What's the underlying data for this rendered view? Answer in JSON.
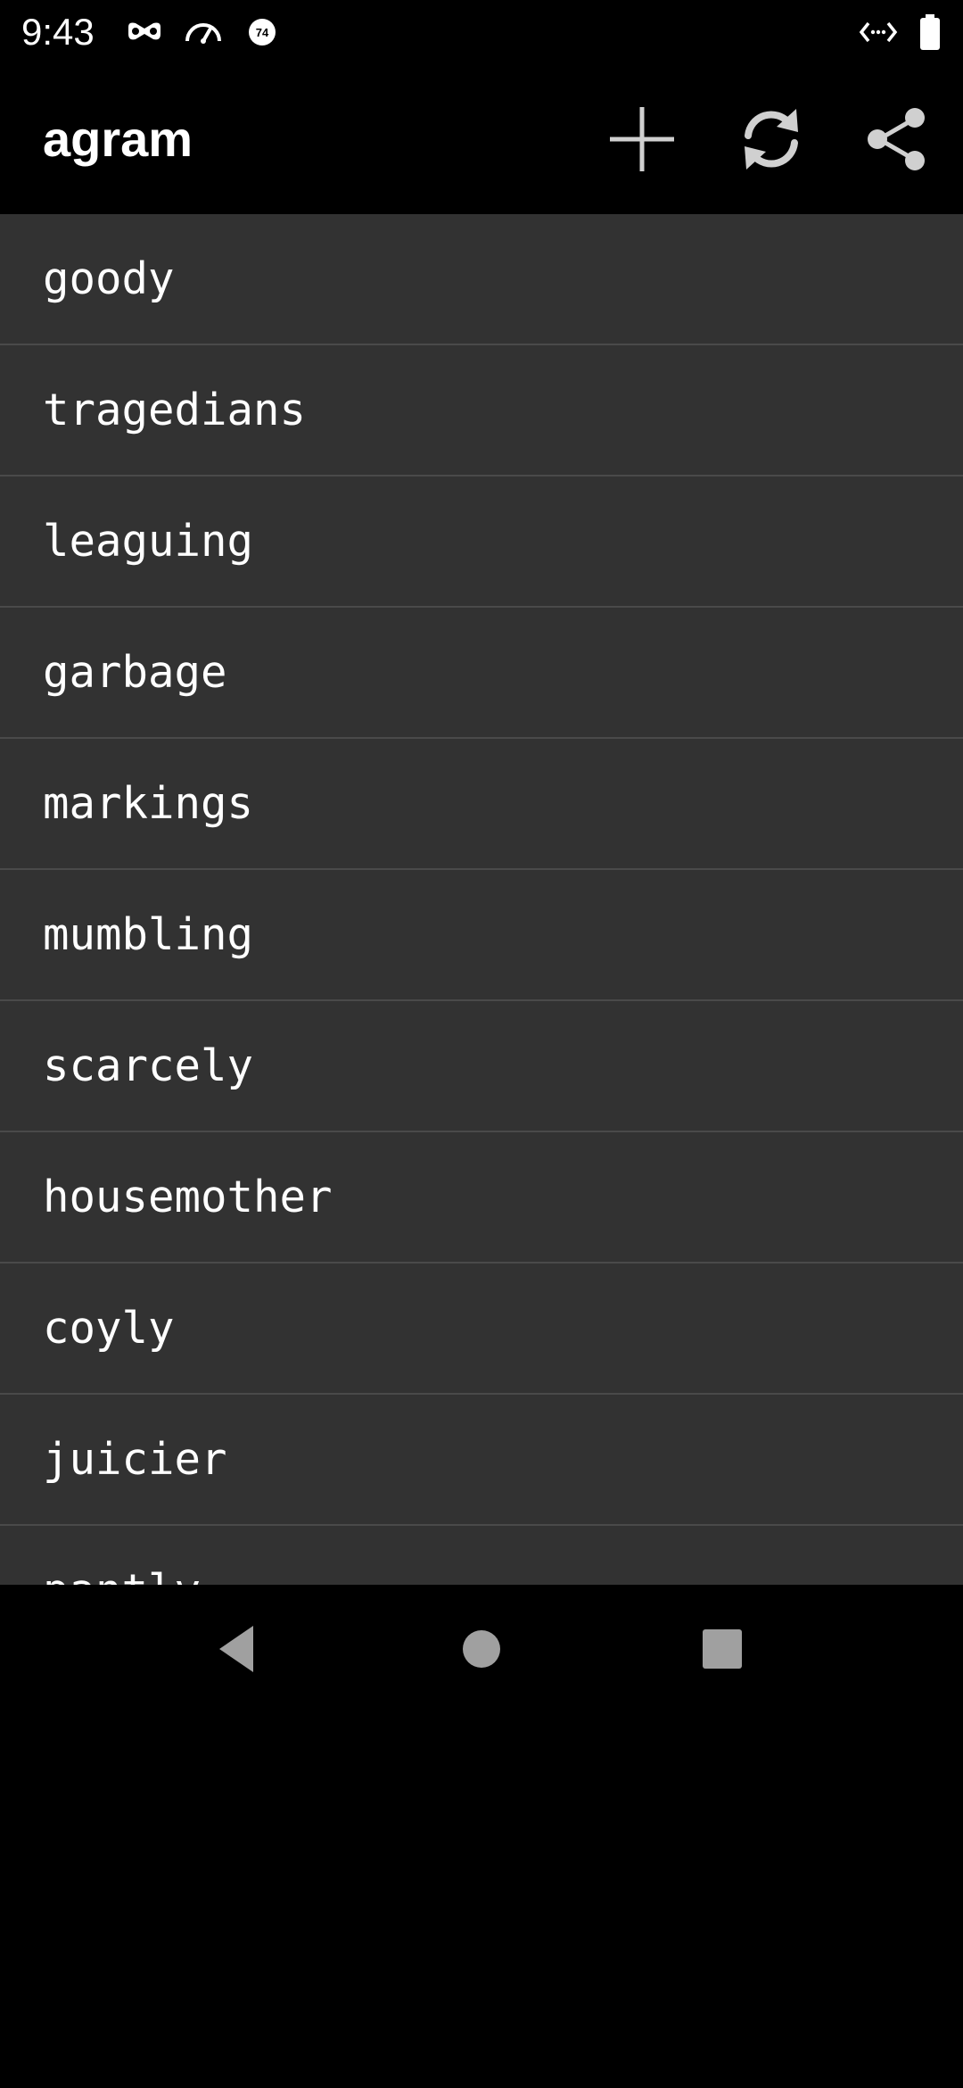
{
  "status_bar": {
    "time": "9:43",
    "battery_badge": "74",
    "icons": [
      "incognito-icon",
      "speedometer-icon",
      "battery-saver-badge-icon",
      "code-arrows-icon",
      "battery-icon"
    ]
  },
  "app_bar": {
    "title": "agram",
    "actions": [
      {
        "icon": "plus-icon",
        "label": "Add"
      },
      {
        "icon": "refresh-icon",
        "label": "Refresh"
      },
      {
        "icon": "share-icon",
        "label": "Share"
      }
    ]
  },
  "words": [
    "goody",
    "tragedians",
    "leaguing",
    "garbage",
    "markings",
    "mumbling",
    "scarcely",
    "housemother",
    "coyly",
    "juicier",
    "pantly"
  ],
  "nav_bar": {
    "buttons": [
      "back-icon",
      "home-icon",
      "recents-icon"
    ]
  },
  "colors": {
    "background": "#000000",
    "list_background": "#323232",
    "divider": "#4a4a4a",
    "icon": "#d0d0d0",
    "nav_icon": "#a0a0a0"
  }
}
